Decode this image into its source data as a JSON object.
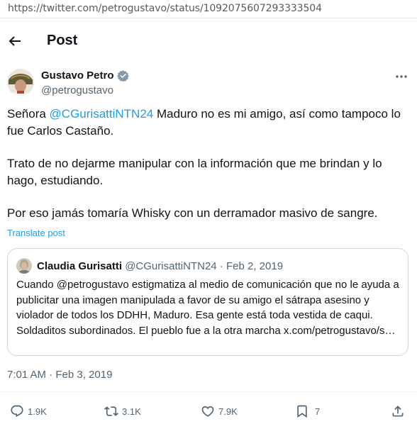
{
  "browser": {
    "url": "https://twitter.com/petrogustavo/status/1092075607293333504"
  },
  "header": {
    "title": "Post"
  },
  "author": {
    "name": "Gustavo Petro",
    "handle": "@petrogustavo"
  },
  "tweet": {
    "line1_pre": "Señora ",
    "line1_mention": "@CGurisattiNTN24",
    "line1_post": " Maduro no es mi amigo, así como tampoco lo fue  Carlos Castaño.",
    "paragraph2": "Trato de no dejarme manipular con la información que me brindan y lo hago, estudiando.",
    "paragraph3": "Por eso jamás tomaría Whisky con un derramador masivo de sangre.",
    "translate_label": "Translate post",
    "timestamp": "7:01 AM · Feb 3, 2019"
  },
  "quote": {
    "name": "Claudia Gurisatti",
    "handle": "@CGurisattiNTN24",
    "separator": " · ",
    "date": "Feb 2, 2019",
    "text": "Cuando @petrogustavo estigmatiza al medio de comunicación que no le ayuda a publicitar una imagen manipulada a favor de su amigo el sátrapa asesino y violador de todos los DDHH, Maduro. Esa gente está toda vestida de caqui. Soldaditos subordinados. El pueblo fue a la otra marcha x.com/petrogustavo/s…"
  },
  "actions": {
    "replies": "1.9K",
    "reposts": "3.1K",
    "likes": "7.9K",
    "bookmarks": "7"
  },
  "colors": {
    "accent": "#1d9bf0",
    "text": "#0f1419",
    "muted": "#536471",
    "border": "#cfd9de"
  },
  "icons": [
    "back-arrow-icon",
    "verified-badge-icon",
    "more-options-icon",
    "reply-icon",
    "repost-icon",
    "like-icon",
    "bookmark-icon",
    "share-icon"
  ]
}
